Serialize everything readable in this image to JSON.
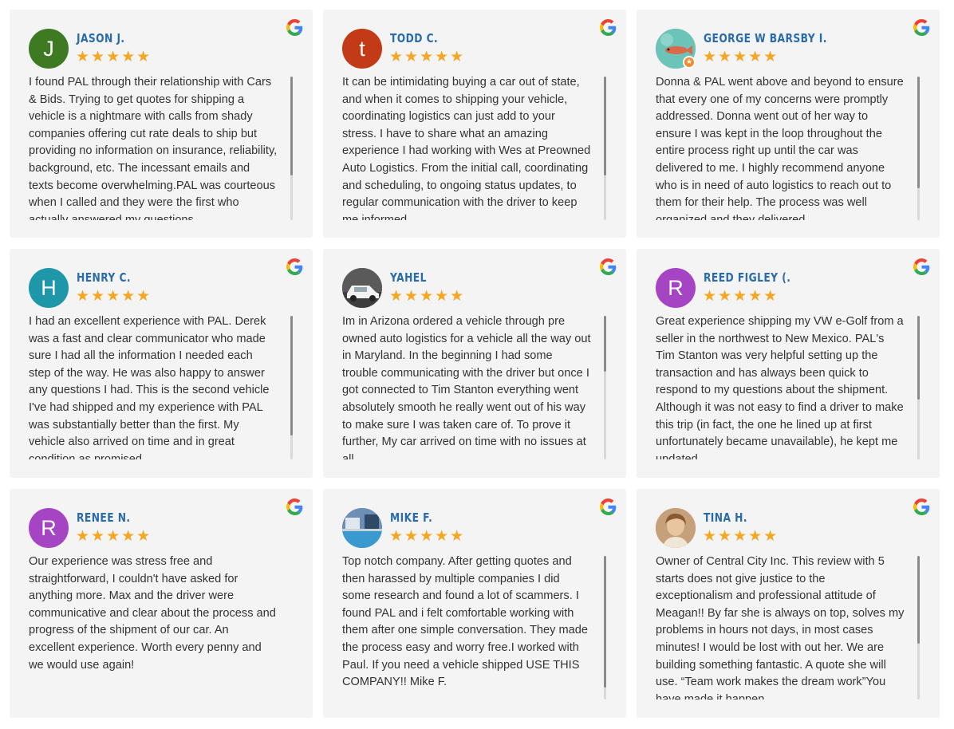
{
  "stars": "★★★★★",
  "reviews": [
    {
      "name": "JASON J.",
      "initial": "J",
      "avatar_color": "#3d7a22",
      "text": "I found PAL through their relationship with Cars & Bids. Trying to get quotes for shipping a vehicle is a nightmare with calls from shady companies offering cut rate deals to ship but providing no information on insurance, reliability, background, etc. The incessant emails and texts become overwhelming.PAL was courteous when I called and they were the first who actually answered my questions."
    },
    {
      "name": "TODD C.",
      "initial": "t",
      "avatar_color": "#c23a16",
      "text": "It can be intimidating buying a car out of state, and when it comes to shipping your vehicle, coordinating logistics can just add to your stress. I have to share what an amazing experience I had working with Wes at Preowned Auto Logistics. From the initial call, coordinating and scheduling, to ongoing status updates, to regular communication with the driver to keep me informed."
    },
    {
      "name": "GEORGE W BARSBY I.",
      "initial": "",
      "avatar_color": "#5fb0a8",
      "text": "Donna & PAL went above and beyond to ensure that every one of my concerns were promptly addressed. Donna went out of her way to ensure I was kept in the loop throughout the entire process right up until the car was delivered to me. I highly recommend anyone who is in need of auto logistics to reach out to them for their help. The process was well organized and they delivered."
    },
    {
      "name": "HENRY C.",
      "initial": "H",
      "avatar_color": "#1e98a8",
      "text": "I had an excellent experience with PAL. Derek was a fast and clear communicator who made sure I had all the information I needed each step of the way. He was also happy to answer any questions I had. This is the second vehicle I've had shipped and my experience with PAL was substantially better than the first. My vehicle also arrived on time and in great condition as promised."
    },
    {
      "name": "YAHEL",
      "initial": "",
      "avatar_color": "#6b6b6b",
      "text": "Im in Arizona ordered a vehicle through pre owned auto logistics for a vehicle all the way out in Maryland. In the beginning I had some trouble communicating with the driver but once I got connected to Tim Stanton everything went absolutely smooth he really went out of his way to make sure I was taken care of. To prove it further, My car arrived on time with no issues at all."
    },
    {
      "name": "REED FIGLEY (.",
      "initial": "R",
      "avatar_color": "#a545c3",
      "text": "Great experience shipping my VW e-Golf from a seller in the northwest to New Mexico. PAL's Tim Stanton was very helpful setting up the transaction and has always been quick to respond to my questions about the shipment. Although it was not easy to find a driver to make this trip (in fact, the one he lined up at first unfortunately became unavailable), he kept me updated."
    },
    {
      "name": "RENEE N.",
      "initial": "R",
      "avatar_color": "#a545c3",
      "text": "Our experience was stress free and straightforward, I couldn't have asked for anything more. Max and the driver were communicative and clear about the process and progress of the shipment of our car. An excellent experience. Worth every penny and we would use again!"
    },
    {
      "name": "MIKE F.",
      "initial": "",
      "avatar_color": "#4a7ab0",
      "text": "Top notch company. After getting quotes and then harassed by multiple companies I did some research and found a lot of scammers. I found PAL and i felt comfortable working with them after one simple conversation. They made the process easy and worry free.I worked with Paul. If you need a vehicle shipped USE THIS COMPANY!! Mike F."
    },
    {
      "name": "TINA H.",
      "initial": "",
      "avatar_color": "#b08a60",
      "text": "Owner of Central City Inc. This review with 5 starts does not give justice to the exceptionalism and professional attitude of Meagan!! By far she is always on top, solves my problems in hours not days, in most cases minutes! I would be lost with out her. We are building something fantastic. A quote she will use. “Team work makes the dream work”You have made it happen."
    }
  ]
}
